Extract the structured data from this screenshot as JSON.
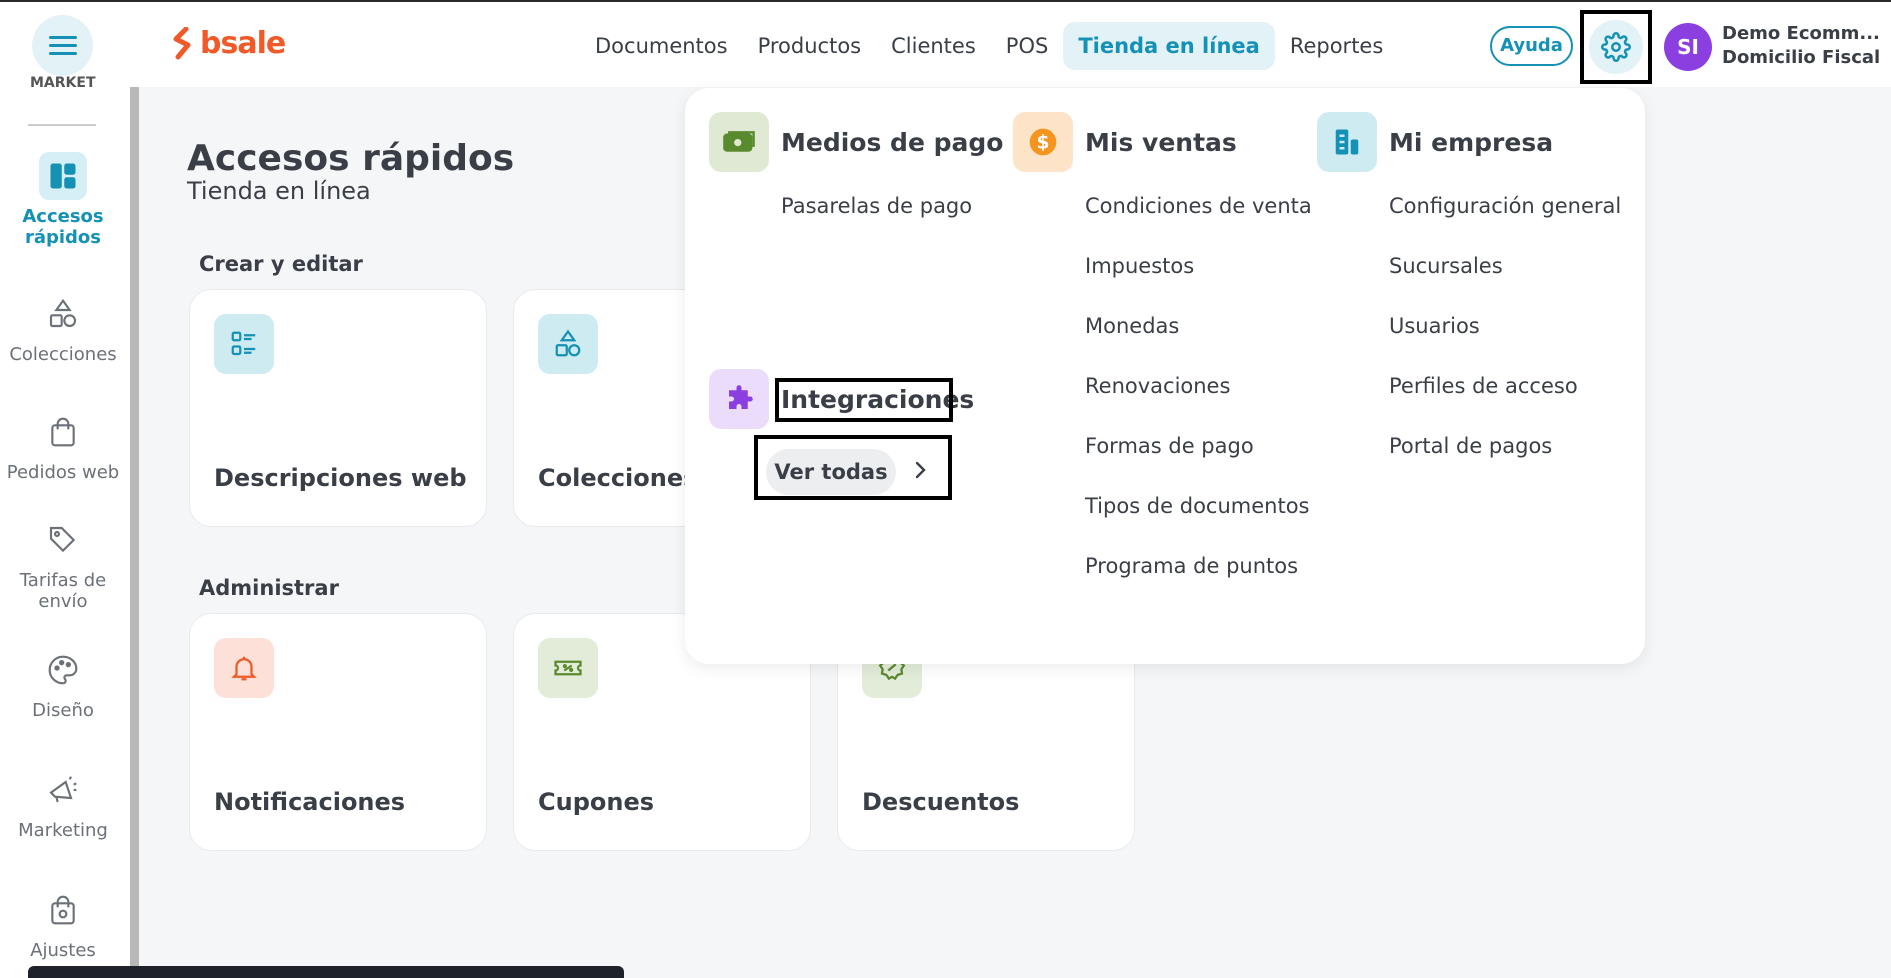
{
  "header": {
    "logo_text": "bsale",
    "nav": [
      "Documentos",
      "Productos",
      "Clientes",
      "POS",
      "Tienda en línea",
      "Reportes"
    ],
    "active_nav": "Tienda en línea",
    "help_label": "Ayuda",
    "avatar_initials": "SI",
    "company_name": "Demo Ecomm...",
    "company_sub": "Domicilio Fiscal"
  },
  "sidebar": {
    "cut_label": "MARKET",
    "items": [
      {
        "label": "Accesos rápidos",
        "icon": "dashboard-icon"
      },
      {
        "label": "Colecciones",
        "icon": "shapes-icon"
      },
      {
        "label": "Pedidos web",
        "icon": "shopping-bag-icon"
      },
      {
        "label": "Tarifas de envío",
        "icon": "tag-icon"
      },
      {
        "label": "Diseño",
        "icon": "palette-icon"
      },
      {
        "label": "Marketing",
        "icon": "megaphone-icon"
      },
      {
        "label": "Ajustes",
        "icon": "bag-gear-icon"
      }
    ]
  },
  "main": {
    "title": "Accesos rápidos",
    "subtitle": "Tienda en línea",
    "section1": "Crear y editar",
    "section2": "Administrar",
    "cards_create": [
      "Descripciones web",
      "Colecciones"
    ],
    "cards_admin": [
      "Notificaciones",
      "Cupones",
      "Descuentos"
    ]
  },
  "dropdown": {
    "payments": {
      "title": "Medios de pago",
      "links": [
        "Pasarelas de pago"
      ]
    },
    "integrations": {
      "title": "Integraciones",
      "button": "Ver todas"
    },
    "sales": {
      "title": "Mis ventas",
      "links": [
        "Condiciones de venta",
        "Impuestos",
        "Monedas",
        "Renovaciones",
        "Formas de pago",
        "Tipos de documentos",
        "Programa de puntos"
      ]
    },
    "company": {
      "title": "Mi empresa",
      "links": [
        "Configuración general",
        "Sucursales",
        "Usuarios",
        "Perfiles de acceso",
        "Portal de pagos"
      ]
    }
  },
  "colors": {
    "accent": "#1491b5",
    "brand": "#f05a28",
    "avatar": "#8b3fe0"
  }
}
